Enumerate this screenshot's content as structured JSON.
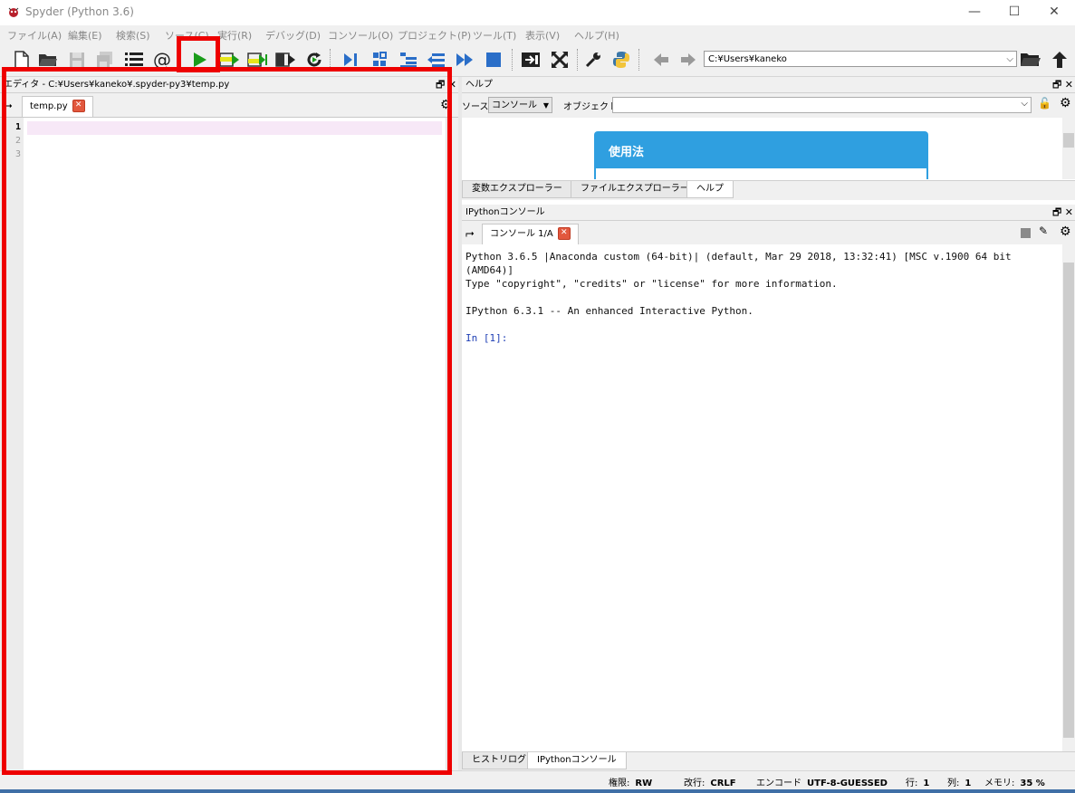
{
  "window": {
    "title": "Spyder (Python 3.6)"
  },
  "menu": [
    "ファイル(A)",
    "編集(E)",
    "検索(S)",
    "ソース(C)",
    "実行(R)",
    "デバッグ(D)",
    "コンソール(O)",
    "プロジェクト(P)",
    "ツール(T)",
    "表示(V)",
    "ヘルプ(H)"
  ],
  "toolbar": {
    "working_dir": "C:¥Users¥kaneko"
  },
  "editor": {
    "header": "エディタ - C:¥Users¥kaneko¥.spyder-py3¥temp.py",
    "tab_label": "temp.py",
    "line_numbers": [
      "1",
      "2",
      "3"
    ]
  },
  "help": {
    "header": "ヘルプ",
    "source_label": "ソース",
    "source_value": "コンソール",
    "object_label": "オブジェクト",
    "usage_title": "使用法",
    "tabs": [
      "変数エクスプローラー",
      "ファイルエクスプローラー",
      "ヘルプ"
    ]
  },
  "console": {
    "header": "IPythonコンソール",
    "tab_label": "コンソール 1/A",
    "lines": [
      "Python 3.6.5 |Anaconda custom (64-bit)| (default, Mar 29 2018, 13:32:41) [MSC v.1900 64 bit",
      "(AMD64)]",
      "Type \"copyright\", \"credits\" or \"license\" for more information.",
      "",
      "IPython 6.3.1 -- An enhanced Interactive Python.",
      "",
      "In [1]:"
    ],
    "tabs": [
      "ヒストリログ",
      "IPythonコンソール"
    ]
  },
  "status": {
    "perm_label": "権限:",
    "perm": "RW",
    "eol_label": "改行:",
    "eol": "CRLF",
    "enc_label": "エンコード",
    "enc": "UTF-8-GUESSED",
    "line_label": "行:",
    "line": "1",
    "col_label": "列:",
    "col": "1",
    "mem_label": "メモリ:",
    "mem": "35 %"
  },
  "colors": {
    "accent_highlight": "#ee0000",
    "help_usage": "#2f9fe0",
    "run_green": "#1a9c1a",
    "ipython_prompt": "#1f3fb5"
  }
}
